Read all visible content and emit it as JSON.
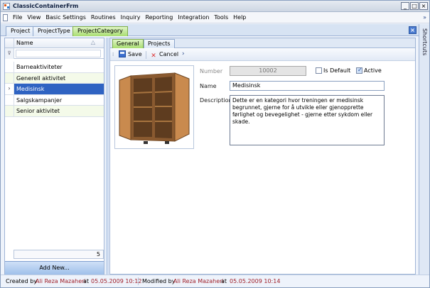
{
  "window": {
    "title": "ClassicContainerFrm",
    "minimize": "_",
    "maximize": "□",
    "close": "×"
  },
  "menu": {
    "items": [
      "File",
      "View",
      "Basic Settings",
      "Routines",
      "Inquiry",
      "Reporting",
      "Integration",
      "Tools",
      "Help"
    ],
    "overflow": "»"
  },
  "top_tabs": [
    {
      "label": "Project",
      "active": false
    },
    {
      "label": "ProjectType",
      "active": false
    },
    {
      "label": "ProjectCategory",
      "active": true
    }
  ],
  "tab_close": "×",
  "shortcuts_label": "Shortcuts",
  "grid": {
    "column": "Name",
    "sort_icon": "sort-icon",
    "filter_placeholder": "",
    "rows": [
      {
        "name": "Barneaktiviteter",
        "selected": false
      },
      {
        "name": "Generell aktivitet",
        "selected": false
      },
      {
        "name": "Medisinsk",
        "selected": true
      },
      {
        "name": "Salgskampanjer",
        "selected": false
      },
      {
        "name": "Senior aktivitet",
        "selected": false
      }
    ],
    "count": "5",
    "add_new": "Add New..."
  },
  "sub_tabs": [
    {
      "label": "General",
      "active": true
    },
    {
      "label": "Projects",
      "active": false
    }
  ],
  "toolbar": {
    "save": "Save",
    "cancel": "Cancel",
    "more": "›"
  },
  "form": {
    "number_label": "Number",
    "number_value": "10002",
    "is_default_label": "Is Default",
    "is_default": false,
    "active_label": "Active",
    "active": true,
    "name_label": "Name",
    "name_value": "Medisinsk",
    "description_label": "Description",
    "description_value": "Dette er en kategori hvor treningen er medisinsk begrunnet, gjerne for å utvikle eller gjenopprette førlighet og bevegelighet - gjerne etter sykdom eller skade."
  },
  "status": {
    "created_by_label": "Created by",
    "created_by": "Ali Reza Mazaheri",
    "created_at_label": "at",
    "created_at": "05.05.2009 10:12",
    "modified_by_label": "Modified by",
    "modified_by": "Ali Reza Mazaheri",
    "modified_at_label": "at",
    "modified_at": "05.05.2009 10:14"
  }
}
